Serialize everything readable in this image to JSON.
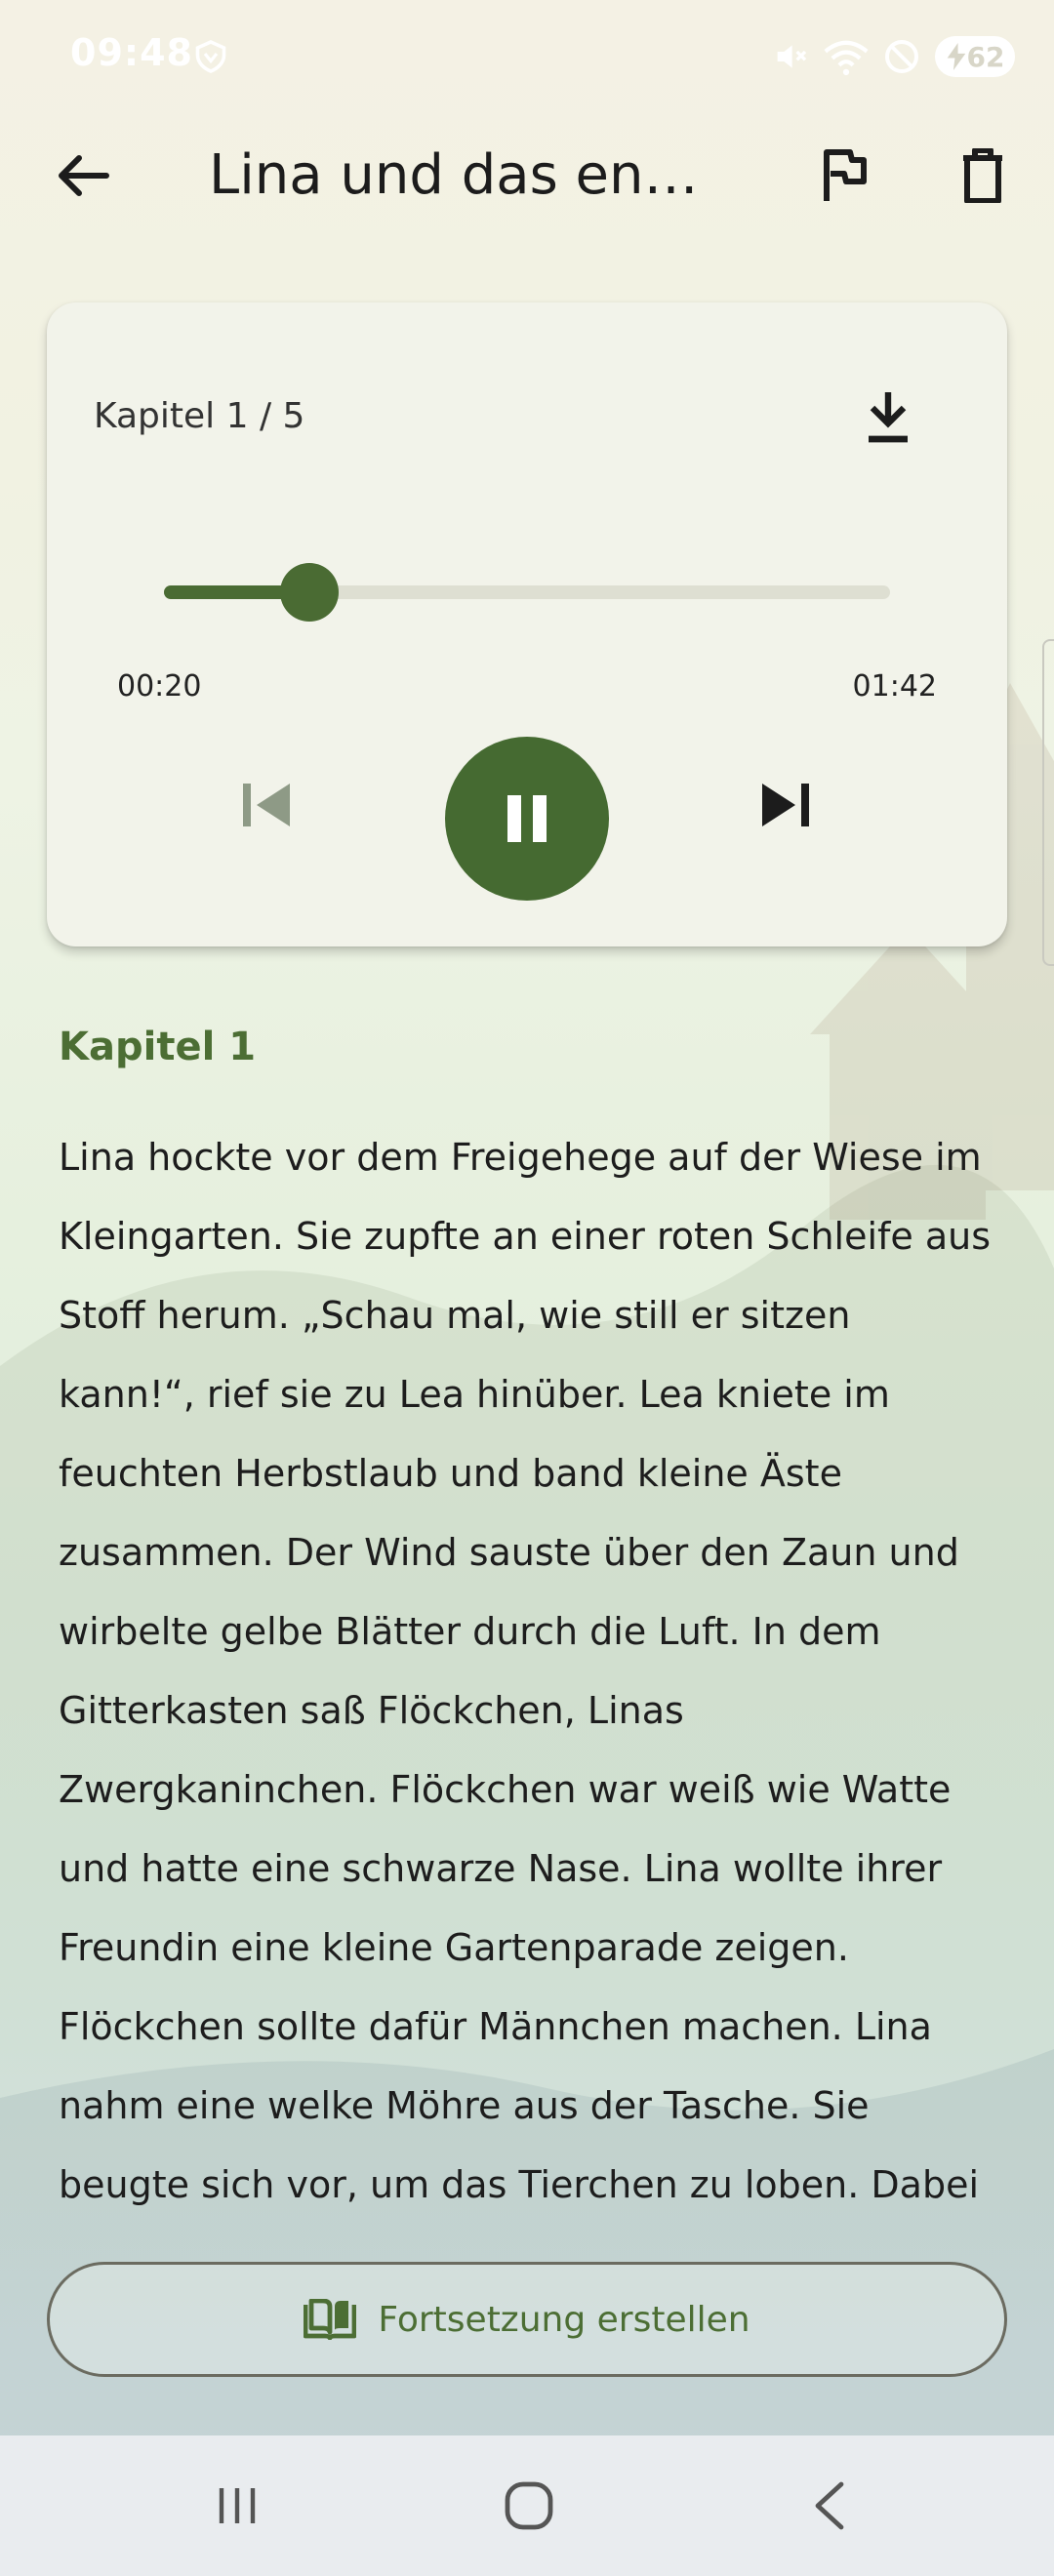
{
  "status_bar": {
    "time": "09:48",
    "battery": "62",
    "icons": [
      "vpn-shield-icon",
      "mute-icon",
      "wifi-icon",
      "dnd-icon",
      "battery-charging-icon"
    ]
  },
  "app_bar": {
    "title": "Lina und das entlauf…",
    "icons": [
      "arrow-back-icon",
      "flag-icon",
      "trash-icon"
    ]
  },
  "player": {
    "chapter_count": "Kapitel 1 / 5",
    "elapsed": "00:20",
    "total": "01:42",
    "progress": 0.2,
    "state": "playing",
    "accent_color": "#4a6b33",
    "icons": [
      "download-icon",
      "skip-previous-icon",
      "pause-icon",
      "skip-next-icon"
    ]
  },
  "chapter": {
    "heading": "Kapitel 1",
    "text": "Lina hockte vor dem Freigehege auf der Wiese im Kleingarten. Sie zupfte an einer roten Schleife aus Stoff herum. „Schau mal, wie still er sitzen kann!“, rief sie zu Lea hinüber. Lea kniete im feuchten Herbstlaub und band kleine Äste zusammen. Der Wind sauste über den Zaun und wirbelte gelbe Blätter durch die Luft. In dem Gitterkasten saß Flöckchen, Linas Zwergkaninchen. Flöckchen war weiß wie Watte und hatte eine schwarze Nase. Lina wollte ihrer Freundin eine kleine Gartenparade zeigen. Flöckchen sollte dafür Männchen machen. Lina nahm eine welke Möhre aus der Tasche. Sie beugte sich vor, um das Tierchen zu loben. Dabei stieß ihr"
  },
  "continue_button": {
    "label": "Fortsetzung erstellen",
    "icon": "book-open-icon"
  },
  "nav_bar": {
    "icons": [
      "recents-icon",
      "home-icon",
      "nav-back-icon"
    ]
  }
}
